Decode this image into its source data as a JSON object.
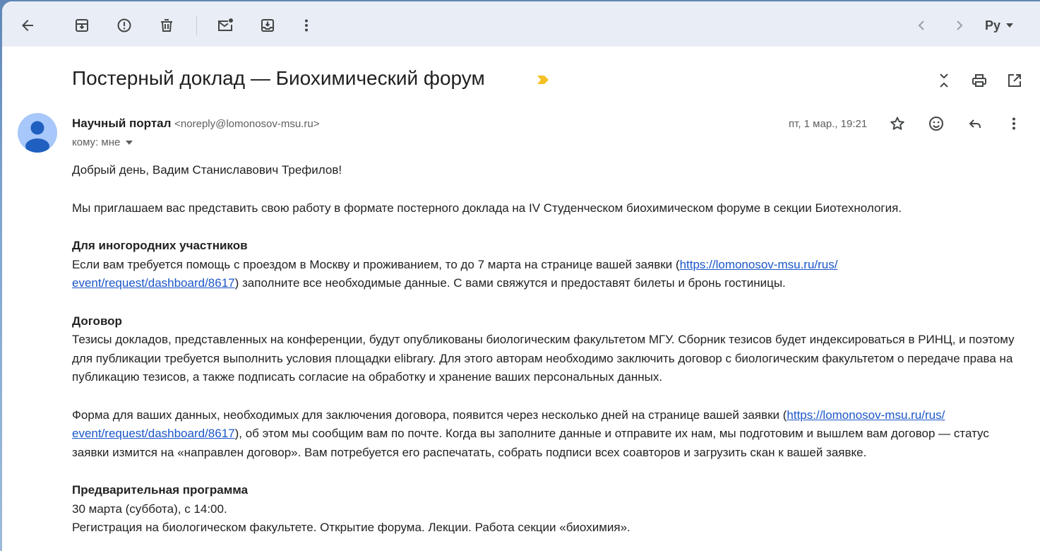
{
  "toolbar": {
    "back": "arrow-left-icon",
    "archive": "archive-icon",
    "spam": "report-spam-icon",
    "delete": "trash-icon",
    "mark_unread": "mark-unread-icon",
    "move": "move-to-icon",
    "more": "more-vert-icon",
    "prev": "chevron-left-icon",
    "next": "chevron-right-icon",
    "lang_label": "Ру"
  },
  "email": {
    "subject": "Постерный доклад — Биохимический форум",
    "sender_name": "Научный портал",
    "sender_email": "<noreply@lomonosov-msu.ru>",
    "to_label": "кому: мне",
    "date": "пт, 1 мар., 19:21",
    "greeting": "Добрый день, Вадим Станиславович Трефилов!",
    "invite": "Мы приглашаем вас представить свою работу в формате постерного доклада на IV Студенческом биохимическом форуме в секции Биотехнология.",
    "travel_heading": "Для иногородних участников",
    "travel_text_1": "Если вам требуется помощь с проездом в Москву и проживанием, то до 7 марта на странице вашей заявки (",
    "link_part_1": "https://lomonosov-msu.ru/rus/",
    "link_part_2": "event/request/dashboard/8617",
    "travel_text_2": ") заполните все необходимые данные. С вами свяжутся и предоставят билеты и бронь гостиницы.",
    "contract_heading": "Договор",
    "contract_text": "Тезисы докладов, представленных на конференции, будут опубликованы биологическим факультетом МГУ. Сборник тезисов будет индексироваться в РИНЦ, и поэтому для публикации требуется выполнить условия площадки elibrary. Для этого авторам необходимо заключить договор с биологическим факультетом о передаче права на публикацию тезисов, а также подписать согласие на обработку и хранение ваших персональных данных.",
    "form_text_1": "Форма для ваших данных, необходимых для заключения договора, появится через несколько дней на странице вашей заявки (",
    "form_text_2": "), об этом мы сообщим вам по почте. Когда вы заполните данные и отправите их нам, мы подготовим и вышлем вам договор — статус заявки измится на «направлен договор». Вам потребуется его распечатать, собрать подписи всех соавторов и загрузить скан к вашей заявке.",
    "program_heading": "Предварительная программа",
    "program_date": "30 марта (суббота), с 14:00.",
    "program_text": "Регистрация на биологическом факультете. Открытие форума. Лекции. Работа секции «биохимия»."
  },
  "colors": {
    "toolbar_bg": "#e9eef6",
    "link": "#1a56c9",
    "importance": "#f6c026",
    "avatar": "#a8c7fa"
  }
}
